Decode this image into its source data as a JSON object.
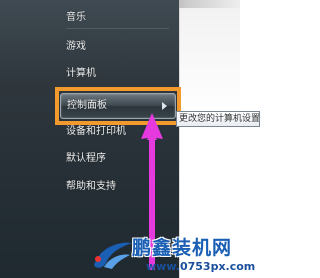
{
  "start_menu": {
    "items": [
      {
        "label": "音乐"
      },
      {
        "label": "游戏"
      },
      {
        "label": "计算机"
      },
      {
        "label": "控制面板"
      },
      {
        "label": "设备和打印机"
      },
      {
        "label": "默认程序"
      },
      {
        "label": "帮助和支持"
      }
    ],
    "tooltip": "更改您的计算机设置"
  },
  "annotation": {
    "highlight_color": "#f29a2e",
    "arrow_color": "#e63adf"
  },
  "watermark": {
    "title": "鹏鑫装机网",
    "url": "www.0753px.com"
  }
}
